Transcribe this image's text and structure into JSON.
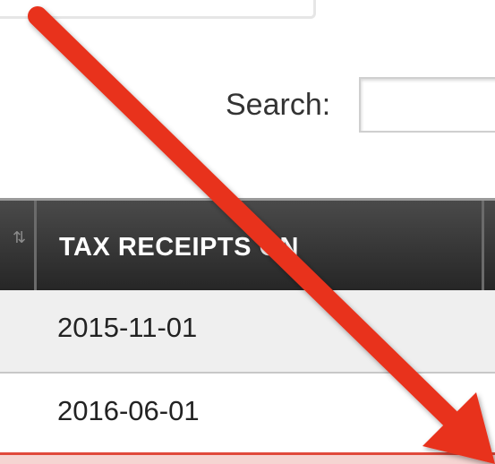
{
  "search": {
    "label": "Search:",
    "value": "",
    "placeholder": ""
  },
  "table": {
    "columns": [
      {
        "key": "tax_receipt_on",
        "label": "TAX RECEIPTS ON"
      }
    ],
    "rows": [
      {
        "tax_receipt_on": "2015-11-01"
      },
      {
        "tax_receipt_on": "2016-06-01"
      }
    ]
  },
  "annotation": {
    "arrow_color": "#e8321f",
    "icon": "arrow-icon"
  },
  "colors": {
    "header_bg": "#2f2f2f",
    "row_alt": "#efefef",
    "accent_red": "#e8321f"
  }
}
